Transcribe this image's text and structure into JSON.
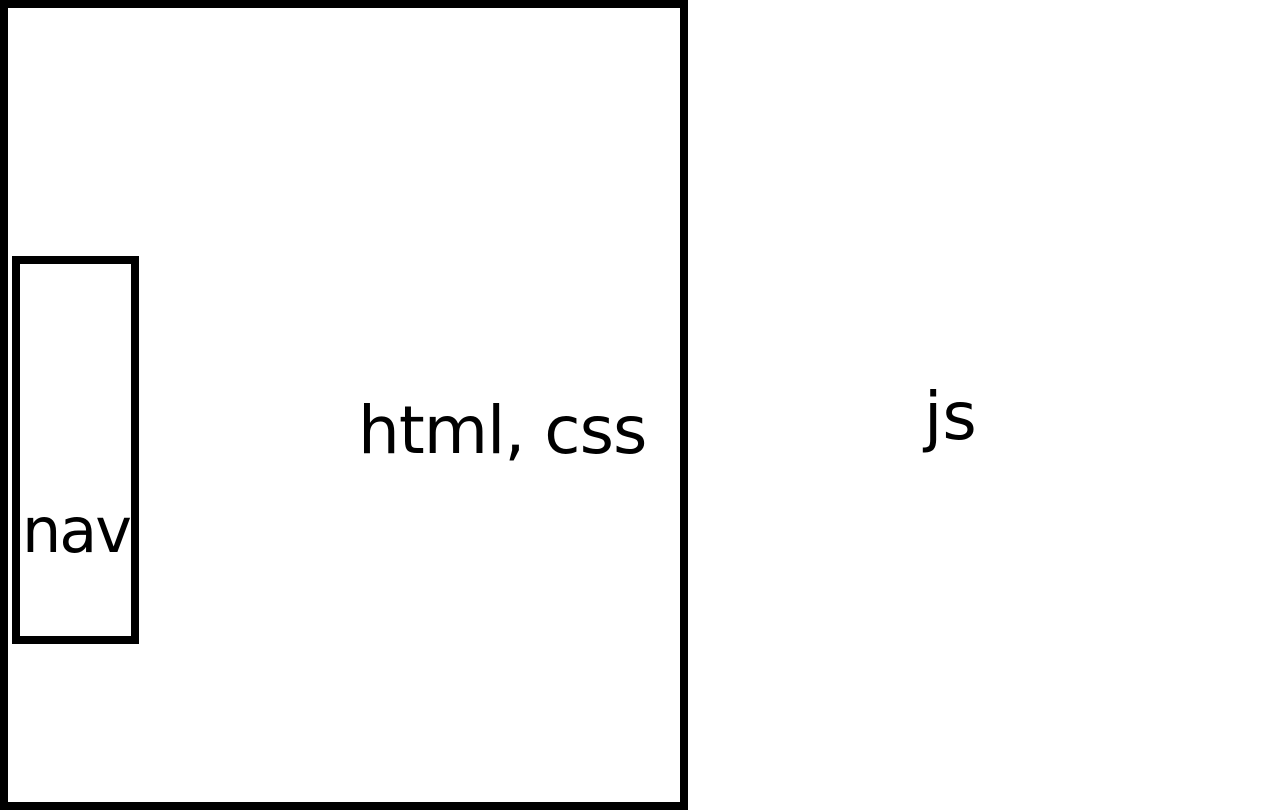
{
  "diagram": {
    "main_box": {
      "label": "html, css"
    },
    "nav_box": {
      "label": "nav"
    },
    "right_area": {
      "label": "js"
    }
  }
}
